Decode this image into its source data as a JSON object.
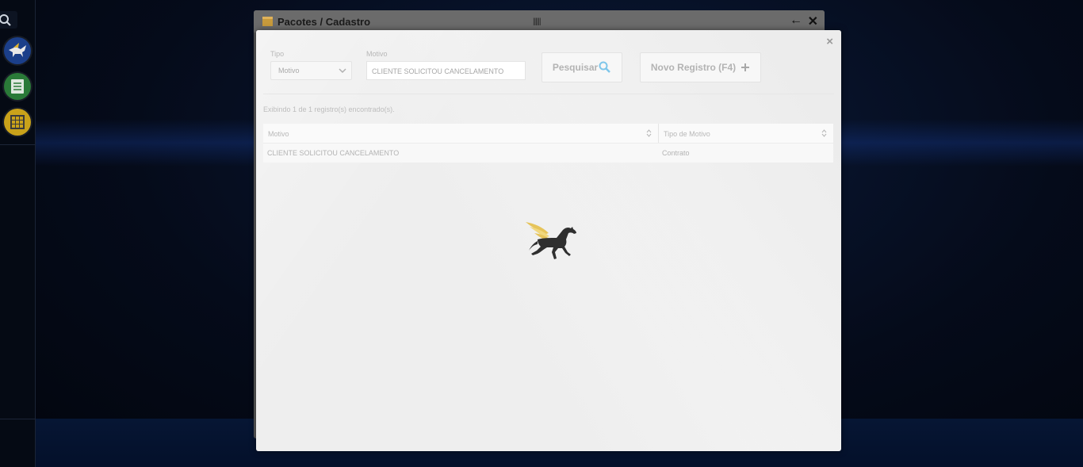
{
  "background_window": {
    "title": "Pacotes / Cadastro",
    "drag_handle": "||||||",
    "back_icon": "arrow-left-icon",
    "close_icon": "close-icon"
  },
  "dock": {
    "items": [
      {
        "name": "search-icon",
        "color": "#0d1422"
      },
      {
        "name": "pegasus-app-icon",
        "color": "#1b3f8a"
      },
      {
        "name": "list-app-icon",
        "color": "#2a7a38"
      },
      {
        "name": "grid-app-icon",
        "color": "#c9a21a"
      }
    ]
  },
  "modal": {
    "close_symbol": "×",
    "filters": {
      "tipo_label": "Tipo",
      "tipo_value": "Motivo",
      "motivo_label": "Motivo",
      "motivo_value": "CLIENTE SOLICITOU CANCELAMENTO"
    },
    "buttons": {
      "search_label": "Pesquisar",
      "new_label": "Novo Registro (F4)"
    },
    "result_info": "Exibindo 1 de 1 registro(s) encontrado(s).",
    "table": {
      "columns": [
        "Motivo",
        "Tipo de Motivo"
      ],
      "rows": [
        [
          "CLIENTE SOLICITOU CANCELAMENTO",
          "Contrato"
        ]
      ]
    },
    "loader_icon": "pegasus-loader-icon"
  }
}
